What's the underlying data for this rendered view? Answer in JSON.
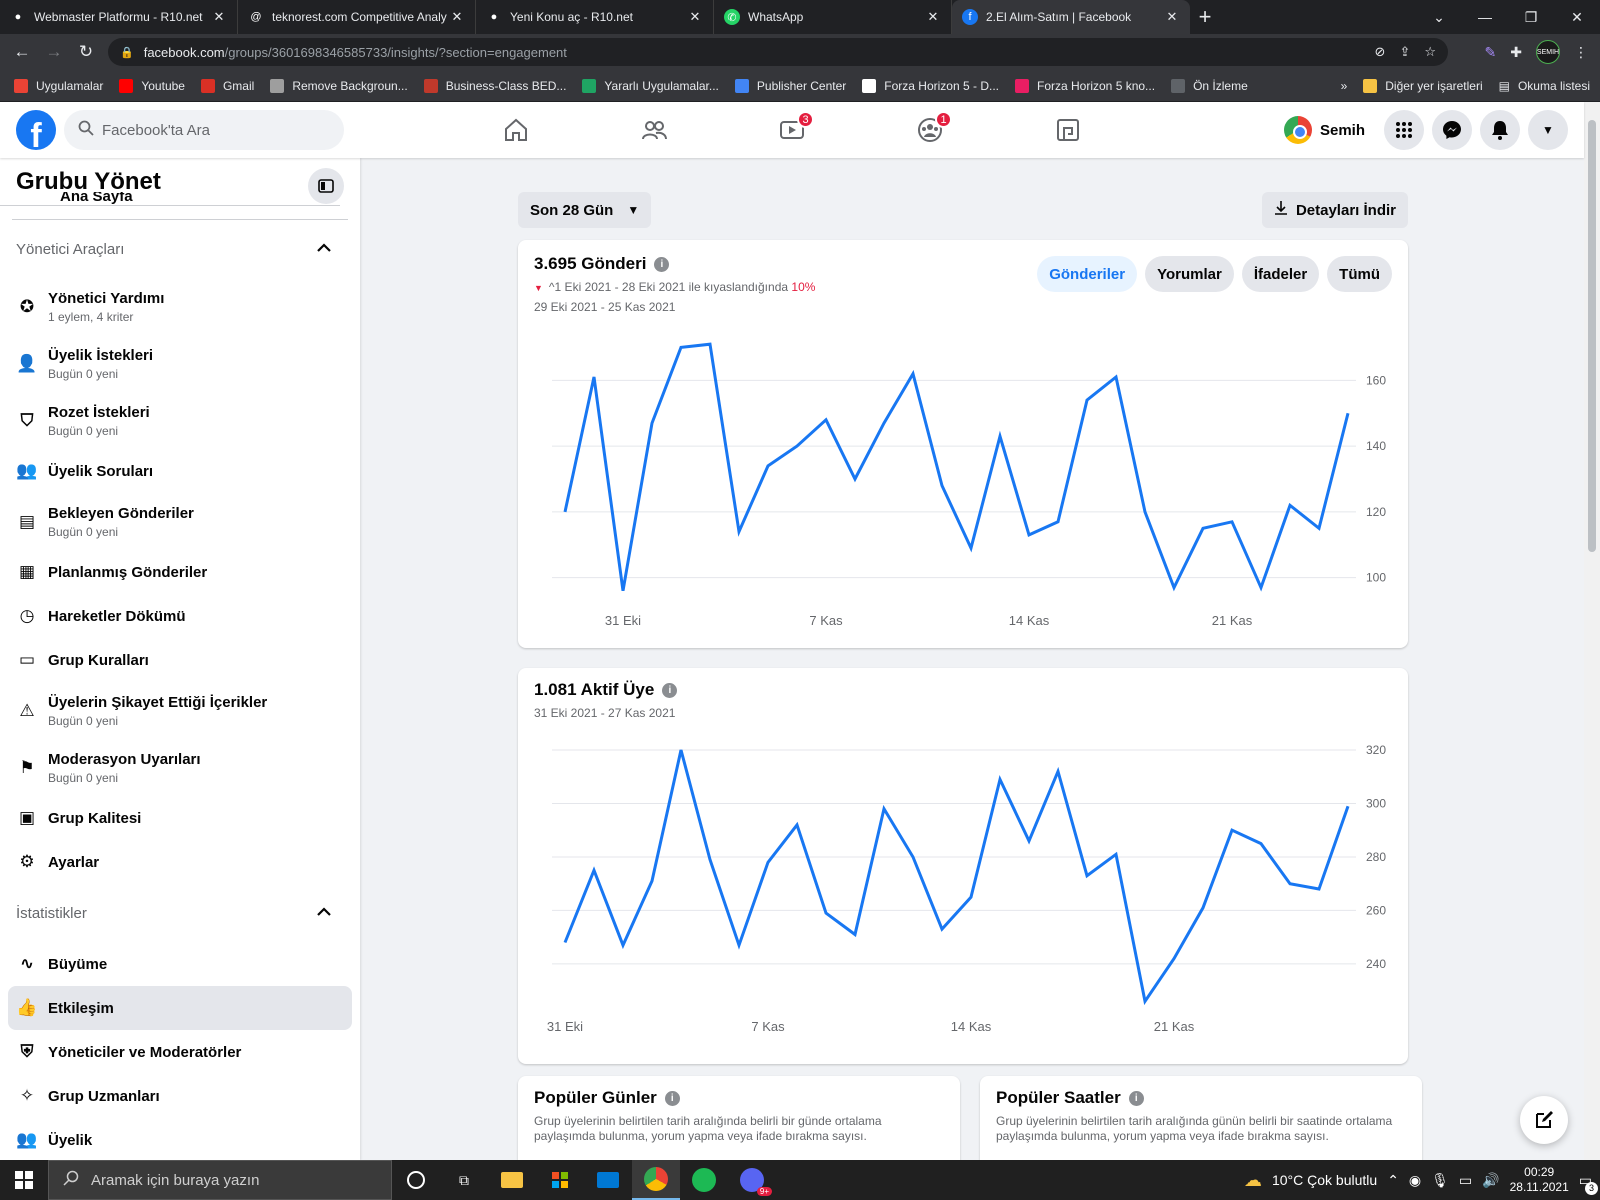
{
  "browser": {
    "tabs": [
      {
        "title": "Webmaster Platformu - R10.net",
        "icon": "r10-icon"
      },
      {
        "title": "teknorest.com Competitive Analy",
        "icon": "at-icon"
      },
      {
        "title": "Yeni Konu aç - R10.net",
        "icon": "r10-icon"
      },
      {
        "title": "WhatsApp",
        "icon": "whatsapp-icon"
      },
      {
        "title": "2.El Alım-Satım | Facebook",
        "icon": "facebook-icon",
        "active": true
      }
    ],
    "url_host": "facebook.com",
    "url_path": "/groups/3601698346585733/insights/?section=engagement",
    "profile_label": "SEMIH",
    "bookmarks": [
      {
        "label": "Uygulamalar",
        "icon": "apps-grid-icon",
        "color": "#ea4335"
      },
      {
        "label": "Youtube",
        "icon": "youtube-icon",
        "color": "#ff0000"
      },
      {
        "label": "Gmail",
        "icon": "gmail-icon",
        "color": "#d93025"
      },
      {
        "label": "Remove Backgroun...",
        "icon": "layers-icon",
        "color": "#9e9e9e"
      },
      {
        "label": "Business-Class BED...",
        "icon": "nf-icon",
        "color": "#c0392b"
      },
      {
        "label": "Yararlı Uygulamalar...",
        "icon": "drive-icon",
        "color": "#1fa463"
      },
      {
        "label": "Publisher Center",
        "icon": "google-icon",
        "color": "#4285f4"
      },
      {
        "label": "Forza Horizon 5 - D...",
        "icon": "forza-icon",
        "color": "#ffffff"
      },
      {
        "label": "Forza Horizon 5 kno...",
        "icon": "w-icon",
        "color": "#e91e63"
      },
      {
        "label": "Ön İzleme",
        "icon": "preview-icon",
        "color": "#5f6368"
      }
    ],
    "bookmarks_more": "»",
    "other_bookmarks": "Diğer yer işaretleri",
    "reading_list": "Okuma listesi"
  },
  "fb": {
    "search_placeholder": "Facebook'ta Ara",
    "watch_badge": "3",
    "groups_badge": "1",
    "user_name": "Semih"
  },
  "sidebar": {
    "title": "Grubu Yönet",
    "partial_item": "Ana Sayfa",
    "admin_section": "Yönetici Araçları",
    "admin_items": [
      {
        "label": "Yönetici Yardımı",
        "sub": "1 eylem, 4 kriter",
        "icon": "shield-star-icon"
      },
      {
        "label": "Üyelik İstekleri",
        "sub": "Bugün 0 yeni",
        "icon": "person-request-icon"
      },
      {
        "label": "Rozet İstekleri",
        "sub": "Bugün 0 yeni",
        "icon": "badge-icon"
      },
      {
        "label": "Üyelik Soruları",
        "sub": "",
        "icon": "person-question-icon"
      },
      {
        "label": "Bekleyen Gönderiler",
        "sub": "Bugün 0 yeni",
        "icon": "pending-posts-icon"
      },
      {
        "label": "Planlanmış Gönderiler",
        "sub": "",
        "icon": "calendar-icon"
      },
      {
        "label": "Hareketler Dökümü",
        "sub": "",
        "icon": "clock-icon"
      },
      {
        "label": "Grup Kuralları",
        "sub": "",
        "icon": "book-icon"
      },
      {
        "label": "Üyelerin Şikayet Ettiği İçerikler",
        "sub": "Bugün 0 yeni",
        "icon": "alert-icon"
      },
      {
        "label": "Moderasyon Uyarıları",
        "sub": "Bugün 0 yeni",
        "icon": "moderation-icon"
      },
      {
        "label": "Grup Kalitesi",
        "sub": "",
        "icon": "clipboard-icon"
      },
      {
        "label": "Ayarlar",
        "sub": "",
        "icon": "gear-icon"
      }
    ],
    "stats_section": "İstatistikler",
    "stats_items": [
      {
        "label": "Büyüme",
        "icon": "growth-icon"
      },
      {
        "label": "Etkileşim",
        "icon": "thumbs-up-icon",
        "selected": true
      },
      {
        "label": "Yöneticiler ve Moderatörler",
        "icon": "shield-icon"
      },
      {
        "label": "Grup Uzmanları",
        "icon": "expert-icon"
      },
      {
        "label": "Üyelik",
        "icon": "members-icon"
      }
    ]
  },
  "main": {
    "range_label": "Son 28 Gün",
    "download_label": "Detayları İndir",
    "posts": {
      "title": "3.695 Gönderi",
      "compare_prefix": "^1 Eki 2021 - 28 Eki 2021 ile kıyaslandığında",
      "compare_pct": "10%",
      "range": "29 Eki 2021 - 25 Kas 2021",
      "pills": [
        "Gönderiler",
        "Yorumlar",
        "İfadeler",
        "Tümü"
      ]
    },
    "active": {
      "title": "1.081 Aktif Üye",
      "range": "31 Eki 2021 - 27 Kas 2021"
    },
    "popular_days": {
      "title": "Popüler Günler",
      "desc": "Grup üyelerinin belirtilen tarih aralığında belirli bir günde ortalama paylaşımda bulunma, yorum yapma veya ifade bırakma sayısı."
    },
    "popular_hours": {
      "title": "Popüler Saatler",
      "desc": "Grup üyelerinin belirtilen tarih aralığında günün belirli bir saatinde ortalama paylaşımda bulunma, yorum yapma veya ifade bırakma sayısı."
    }
  },
  "chart_data": [
    {
      "type": "line",
      "x": [
        "29 Eki",
        "30 Eki",
        "31 Eki",
        "1 Kas",
        "2 Kas",
        "3 Kas",
        "4 Kas",
        "5 Kas",
        "6 Kas",
        "7 Kas",
        "8 Kas",
        "9 Kas",
        "10 Kas",
        "11 Kas",
        "12 Kas",
        "13 Kas",
        "14 Kas",
        "15 Kas",
        "16 Kas",
        "17 Kas",
        "18 Kas",
        "19 Kas",
        "20 Kas",
        "21 Kas",
        "22 Kas",
        "23 Kas",
        "24 Kas",
        "25 Kas"
      ],
      "values": [
        120,
        161,
        96,
        147,
        170,
        171,
        114,
        134,
        140,
        148,
        130,
        147,
        162,
        128,
        109,
        143,
        113,
        117,
        154,
        161,
        120,
        97,
        115,
        117,
        97,
        122,
        115,
        150
      ],
      "xticks": [
        "31 Eki",
        "7 Kas",
        "14 Kas",
        "21 Kas"
      ],
      "yticks": [
        100,
        120,
        140,
        160
      ],
      "ylim": [
        92,
        175
      ],
      "grid": true,
      "color": "#1877f2"
    },
    {
      "type": "line",
      "x": [
        "31 Eki",
        "1 Kas",
        "2 Kas",
        "3 Kas",
        "4 Kas",
        "5 Kas",
        "6 Kas",
        "7 Kas",
        "8 Kas",
        "9 Kas",
        "10 Kas",
        "11 Kas",
        "12 Kas",
        "13 Kas",
        "14 Kas",
        "15 Kas",
        "16 Kas",
        "17 Kas",
        "18 Kas",
        "19 Kas",
        "20 Kas",
        "21 Kas",
        "22 Kas",
        "23 Kas",
        "24 Kas",
        "25 Kas",
        "26 Kas",
        "27 Kas"
      ],
      "values": [
        248,
        275,
        247,
        271,
        320,
        279,
        247,
        278,
        292,
        259,
        251,
        298,
        280,
        253,
        265,
        309,
        286,
        312,
        273,
        281,
        226,
        242,
        261,
        290,
        285,
        270,
        268,
        299
      ],
      "xticks": [
        "31 Eki",
        "7 Kas",
        "14 Kas",
        "21 Kas"
      ],
      "yticks": [
        240,
        260,
        280,
        300,
        320
      ],
      "ylim": [
        225,
        323
      ],
      "grid": true,
      "color": "#1877f2"
    }
  ],
  "taskbar": {
    "search_placeholder": "Aramak için buraya yazın",
    "weather": "10°C  Çok bulutlu",
    "time": "00:29",
    "date": "28.11.2021",
    "notif_count": "3",
    "discord_badge": "9+"
  }
}
